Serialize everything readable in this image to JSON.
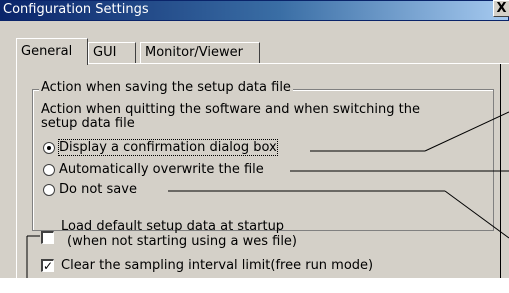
{
  "window": {
    "title": "Configuration Settings",
    "close_label": "X"
  },
  "tabs": [
    {
      "label": "General"
    },
    {
      "label": "GUI"
    },
    {
      "label": "Monitor/Viewer"
    }
  ],
  "group": {
    "title": "Action when saving the setup data file",
    "description_line1": "Action when quitting the software and when switching the",
    "description_line2": "setup data file",
    "options": [
      {
        "label": "Display a confirmation dialog box",
        "selected": true
      },
      {
        "label": "Automatically overwrite the file",
        "selected": false
      },
      {
        "label": "Do not save",
        "selected": false
      }
    ]
  },
  "checkboxes": [
    {
      "label_line1": "Load default setup data at startup",
      "label_line2": "(when not starting using a wes file)",
      "checked": false
    },
    {
      "label_line1": "Clear the sampling interval limit(free run mode)",
      "checked": true
    }
  ]
}
